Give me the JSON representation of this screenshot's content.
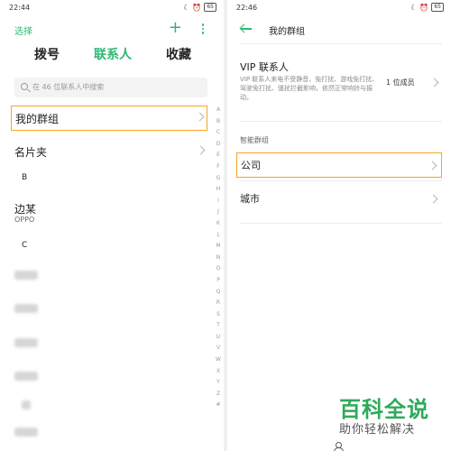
{
  "left": {
    "status": {
      "time": "22:44",
      "signal": "HD",
      "battery": "65"
    },
    "top_bar": {
      "select_label": "选择"
    },
    "tabs": [
      {
        "label": "拨号"
      },
      {
        "label": "联系人",
        "active": true
      },
      {
        "label": "收藏"
      }
    ],
    "search": {
      "placeholder": "在 46 位联系人中搜索"
    },
    "groups": [
      {
        "label": "我的群组",
        "highlighted": true
      },
      {
        "label": "名片夹"
      }
    ],
    "sections": [
      {
        "letter": "B",
        "contacts": [
          {
            "name": "边某",
            "sub": "OPPO"
          }
        ]
      },
      {
        "letter": "C"
      }
    ],
    "alphabet": [
      "A",
      "B",
      "C",
      "D",
      "E",
      "F",
      "G",
      "H",
      "I",
      "J",
      "K",
      "L",
      "M",
      "N",
      "O",
      "P",
      "Q",
      "R",
      "S",
      "T",
      "U",
      "V",
      "W",
      "X",
      "Y",
      "Z",
      "#"
    ]
  },
  "right": {
    "status": {
      "time": "22:46",
      "signal": "HD",
      "battery": "65"
    },
    "title": "我的群组",
    "vip": {
      "title": "VIP 联系人",
      "description": "VIP 联系人来电不受静音、免打扰、游戏免打扰、驾驶免打扰、骚扰拦截影响，依然正常响铃与振动。",
      "count": "1 位成员"
    },
    "smart_groups_header": "智能群组",
    "smart_groups": [
      {
        "label": "公司",
        "highlighted": true
      },
      {
        "label": "城市"
      }
    ]
  },
  "watermark": {
    "line1": "百科全说",
    "line2": "助你轻松解决"
  },
  "colors": {
    "accent": "#2eb872",
    "highlight": "#f5a623"
  }
}
